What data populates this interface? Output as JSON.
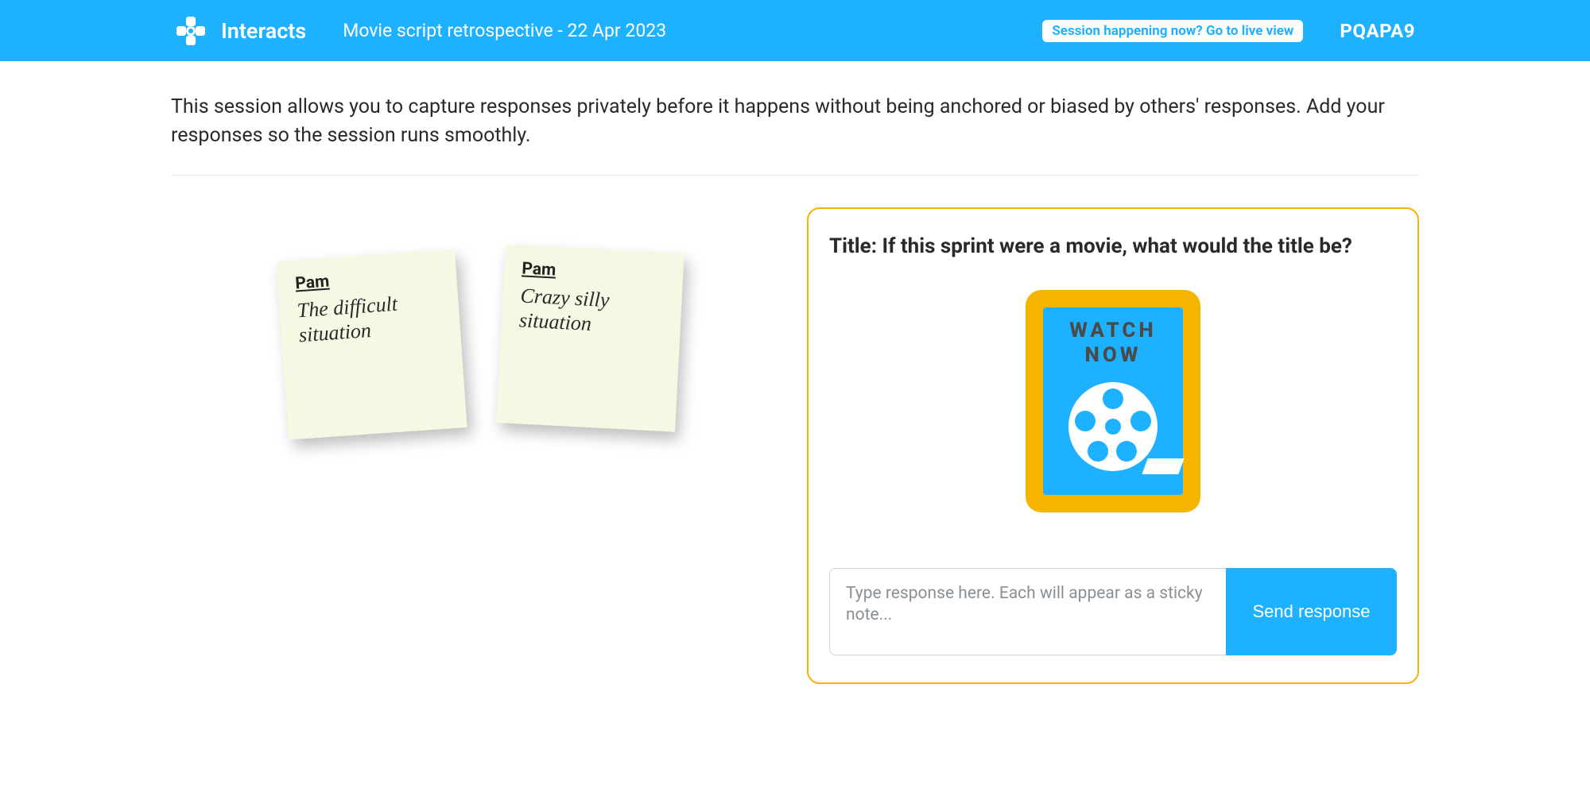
{
  "header": {
    "brand": "Interacts",
    "session_title": "Movie script retrospective - 22 Apr 2023",
    "live_view_label": "Session happening now? Go to live view",
    "session_code": "PQAPA9"
  },
  "intro_text": "This session allows you to capture responses privately before it happens without being anchored or biased by others' responses. Add your responses so the session runs smoothly.",
  "notes": [
    {
      "author": "Pam",
      "text": "The difficult situation"
    },
    {
      "author": "Pam",
      "text": "Crazy silly situation"
    }
  ],
  "prompt": {
    "title_label": "Title: If this sprint were a movie, what would the title be?",
    "poster_line1": "WATCH",
    "poster_line2": "NOW",
    "input_placeholder": "Type response here. Each will appear as a sticky note...",
    "send_label": "Send response"
  }
}
